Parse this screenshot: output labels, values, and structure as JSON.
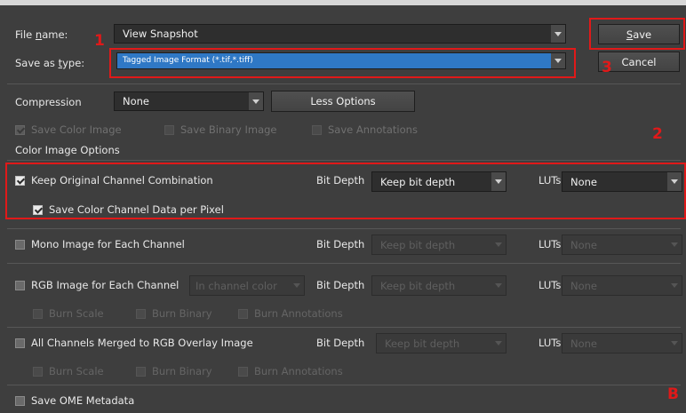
{
  "dialog": {
    "file_name_label_pre": "File ",
    "file_name_label_u": "n",
    "file_name_label_post": "ame:",
    "file_name_value": "View Snapshot",
    "save_type_label_pre": "Save as ",
    "save_type_label_u": "t",
    "save_type_label_post": "ype:",
    "save_type_value": "Tagged Image Format (*.tif,*.tiff)",
    "save_label_u": "S",
    "save_label_post": "ave",
    "cancel_label": "Cancel"
  },
  "options": {
    "compression_label": "Compression",
    "compression_value": "None",
    "less_options_label": "Less Options",
    "save_color_image": "Save Color Image",
    "save_binary_image": "Save Binary Image",
    "save_annotations": "Save Annotations"
  },
  "color_image_options": {
    "section_title": "Color Image Options",
    "bit_depth_label": "Bit Depth",
    "luts_label": "LUTs",
    "rows": [
      {
        "label": "Keep Original Channel Combination",
        "bit_depth": "Keep bit depth",
        "luts": "None",
        "checked": true,
        "enabled": true
      },
      {
        "label": "Mono Image for Each Channel",
        "bit_depth": "Keep bit depth",
        "luts": "None",
        "checked": false,
        "enabled": false
      },
      {
        "label": "RGB Image for Each Channel",
        "channel_color": "In channel color",
        "bit_depth": "Keep bit depth",
        "luts": "None",
        "checked": false,
        "enabled": false
      },
      {
        "label": "All Channels Merged to RGB Overlay Image",
        "bit_depth": "Keep bit depth",
        "luts": "None",
        "checked": false,
        "enabled": false
      }
    ],
    "save_color_channel_data": "Save Color Channel Data per Pixel",
    "burn_scale": "Burn Scale",
    "burn_binary": "Burn Binary",
    "burn_annotations": "Burn Annotations",
    "save_ome_metadata": "Save OME Metadata"
  },
  "annotations": {
    "marker_1": "1",
    "marker_2": "2",
    "marker_3": "3",
    "marker_b": "B",
    "color": "#e01919"
  }
}
